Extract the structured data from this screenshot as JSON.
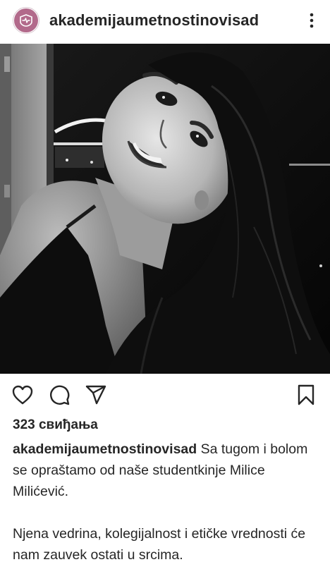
{
  "post": {
    "username": "akademijaumetnostinovisad",
    "likes": "323 свиђања",
    "caption_user": "akademijaumetnostinovisad",
    "caption_line1": "Sa tugom i bolom se opraštamo od naše studentkinje Milice Milićević.",
    "caption_line2": "Njena vedrina, kolegijalnost i etičke vrednosti će nam zauvek ostati u srcima."
  },
  "icons": {
    "avatar": "academy-logo-icon",
    "more": "more-vertical-icon",
    "like": "heart-icon",
    "comment": "comment-icon",
    "share": "send-icon",
    "save": "bookmark-icon"
  },
  "colors": {
    "text": "#262626",
    "logo": "#b26a8b",
    "background": "#ffffff"
  }
}
